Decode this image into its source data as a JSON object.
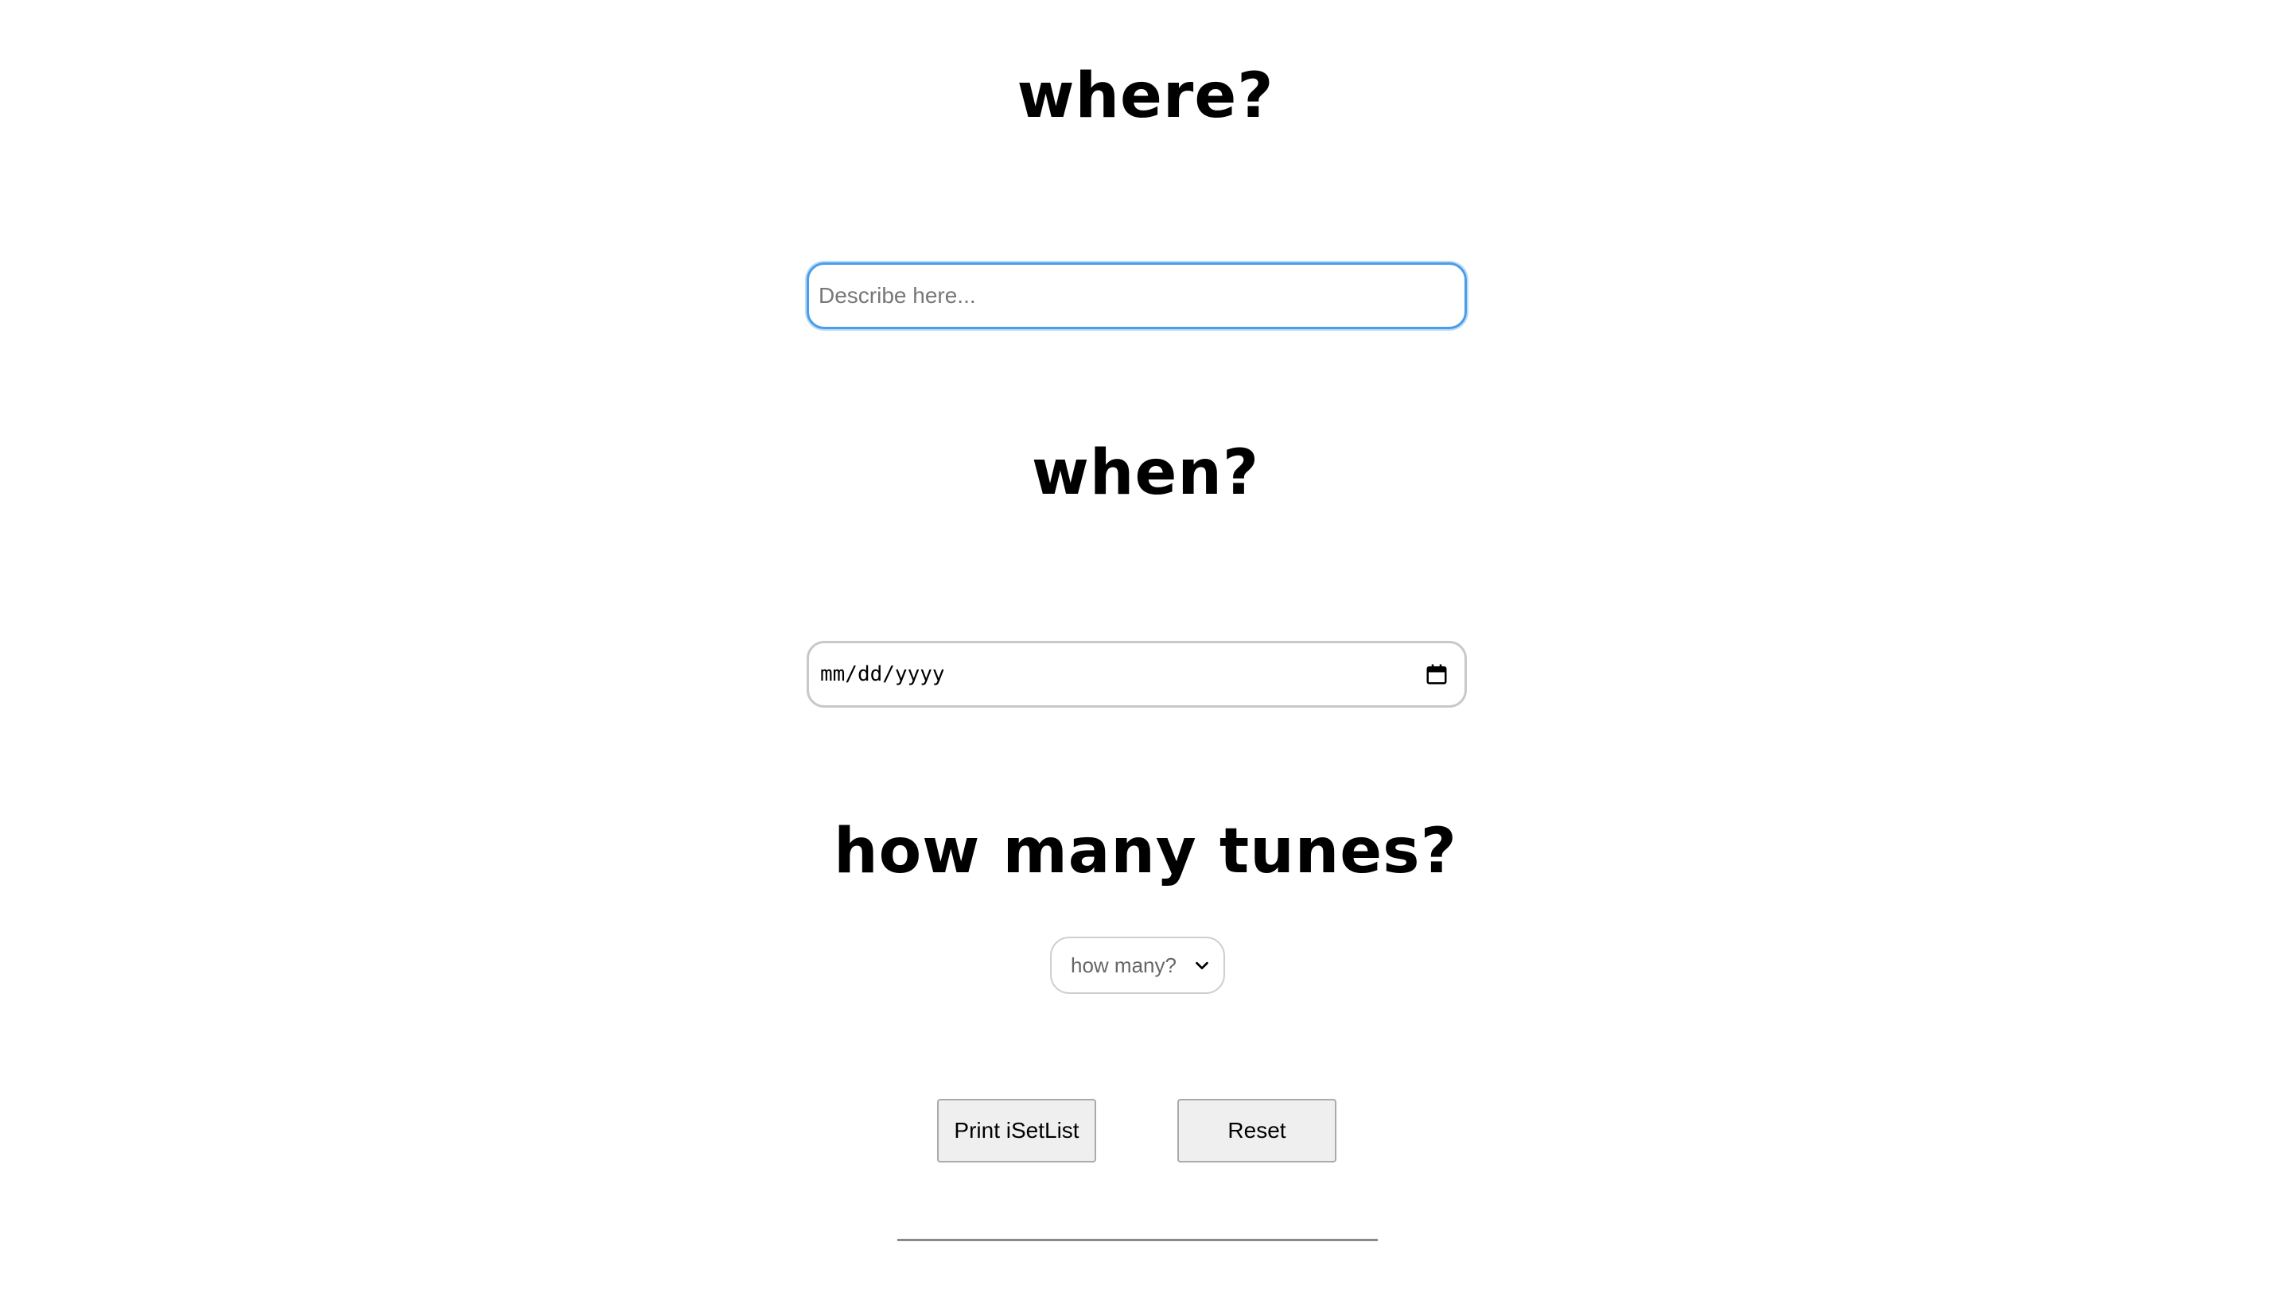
{
  "form": {
    "where_heading": "where?",
    "where_placeholder": "Describe here...",
    "when_heading": "when?",
    "date_placeholder": "mm/dd/yyyy",
    "tunes_heading": "how many tunes?",
    "tunes_select_value": "how many?"
  },
  "buttons": {
    "print_label": "Print iSetList",
    "reset_label": "Reset"
  },
  "icons": {
    "date_picker": "calendar-icon",
    "select_toggle": "chevron-down-icon"
  },
  "colors": {
    "focus_border": "#4a9de8",
    "button_bg": "#efefef"
  }
}
